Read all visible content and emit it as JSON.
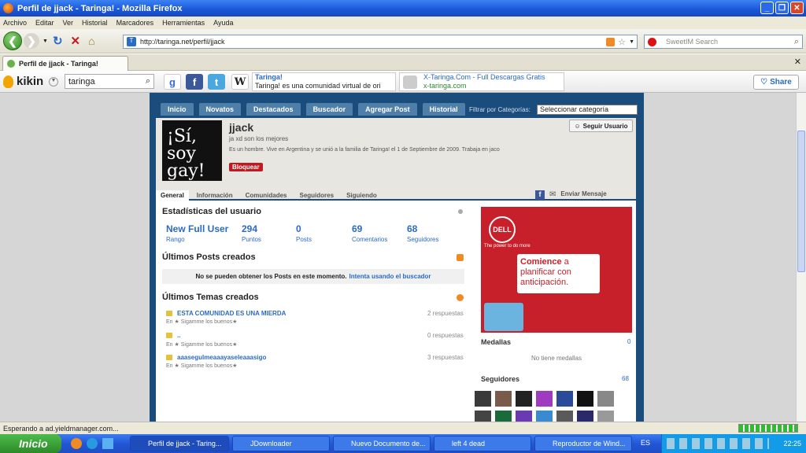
{
  "window": {
    "title": "Perfil de jjack - Taringa! - Mozilla Firefox"
  },
  "menu": [
    "Archivo",
    "Editar",
    "Ver",
    "Historial",
    "Marcadores",
    "Herramientas",
    "Ayuda"
  ],
  "nav": {
    "url": "http://taringa.net/perfil/jjack",
    "search_placeholder": "SweetIM Search"
  },
  "tab": {
    "label": "Perfil de jjack - Taringa!"
  },
  "kikin": {
    "logo": "kikin",
    "query": "taringa",
    "result1_title": "Taringa!",
    "result1_text": "Taringa! es una comunidad virtual de ori",
    "result2_title": "X-Taringa.Com - Full Descargas Gratis",
    "result2_url": "x-taringa.com",
    "share": "Share"
  },
  "site": {
    "nav": [
      "Inicio",
      "Novatos",
      "Destacados",
      "Buscador",
      "Agregar Post",
      "Historial"
    ],
    "filter_label": "Filtrar por Categorías:",
    "filter_value": "Seleccionar categoría",
    "avatar_text": "¡Sí, soy gay!",
    "username": "jjack",
    "tagline": "ja xd son los mejores",
    "bio": "Es un hombre. Vive en Argentina y se unió a la familia de Taringa! el 1 de Septiembre de 2009. Trabaja en jaco",
    "follow": "Seguir Usuario",
    "block": "Bloquear",
    "tabs": [
      "General",
      "Información",
      "Comunidades",
      "Seguidores",
      "Siguiendo"
    ],
    "send_msg": "Enviar Mensaje",
    "stats_title": "Estadísticas del usuario",
    "stats": [
      {
        "value": "New Full User",
        "label": "Rango"
      },
      {
        "value": "294",
        "label": "Puntos"
      },
      {
        "value": "0",
        "label": "Posts"
      },
      {
        "value": "69",
        "label": "Comentarios"
      },
      {
        "value": "68",
        "label": "Seguidores"
      }
    ],
    "posts_title": "Últimos Posts creados",
    "no_posts": "No se pueden obtener los Posts en este momento.",
    "no_posts_link": "Intenta usando el buscador",
    "topics_title": "Últimos Temas creados",
    "topics": [
      {
        "title": "ESTA COMUNIDAD ES UNA MIERDA",
        "sub": "En ★ Sigamme los buenos★",
        "replies": "2 respuestas"
      },
      {
        "title": "..",
        "sub": "En ★ Sigamme los buenos★",
        "replies": "0 respuestas"
      },
      {
        "title": "aaasegulmeaaayaseleaaasigo",
        "sub": "En ★ Sigamme los buenos★",
        "replies": "3 respuestas"
      }
    ],
    "ad": {
      "brand": "DELL",
      "slogan": "The power to do more",
      "cta_strong": "Comience",
      "cta_text": "a planificar con anticipación."
    },
    "medals_title": "Medallas",
    "medals_count": "0",
    "no_medals": "No tiene medallas",
    "followers_title": "Seguidores",
    "followers_count": "68"
  },
  "status": {
    "text": "Esperando a ad.yieldmanager.com..."
  },
  "taskbar": {
    "start": "Inicio",
    "items": [
      "Perfil de jjack - Taring...",
      "JDownloader",
      "Nuevo Documento de...",
      "left 4 dead",
      "Reproductor de Wind..."
    ],
    "lang": "ES",
    "clock": "22:25"
  }
}
